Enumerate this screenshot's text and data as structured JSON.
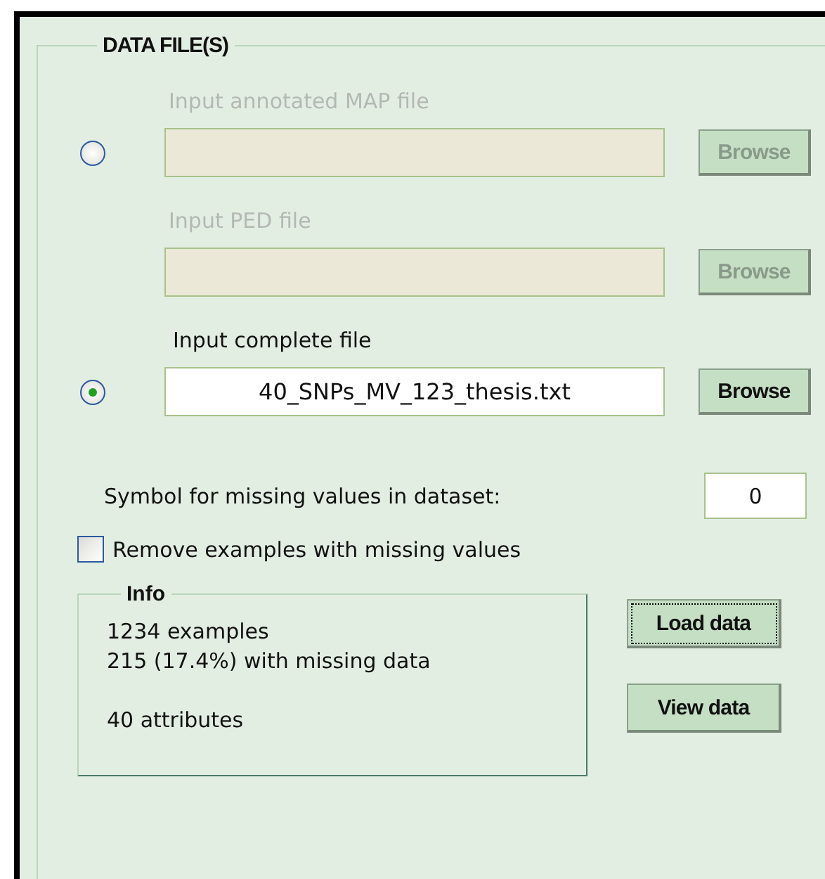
{
  "group": {
    "title": "DATA FILE(S)"
  },
  "file_inputs": [
    {
      "kind": "radio",
      "label": "Input annotated MAP file",
      "selected": false,
      "disabled": true,
      "browse": "Browse"
    },
    {
      "kind": "plain",
      "label": "Input PED file",
      "disabled": true,
      "browse": "Browse"
    },
    {
      "kind": "radio",
      "label": "Input complete file",
      "value": "40_SNPs_MV_123_thesis.txt",
      "selected": true,
      "disabled": false,
      "browse": "Browse"
    }
  ],
  "missing_symbol": {
    "label": "Symbol for missing values in dataset:",
    "value": "0"
  },
  "remove_missing": {
    "label": "Remove examples with missing values",
    "checked": false
  },
  "info": {
    "title": "Info",
    "paragraphs": [
      [
        "1234 examples",
        "215 (17.4%) with missing data"
      ],
      [
        "40 attributes"
      ]
    ]
  },
  "buttons": [
    {
      "label": "Load data",
      "focused": true
    },
    {
      "label": "View data",
      "focused": false
    }
  ]
}
